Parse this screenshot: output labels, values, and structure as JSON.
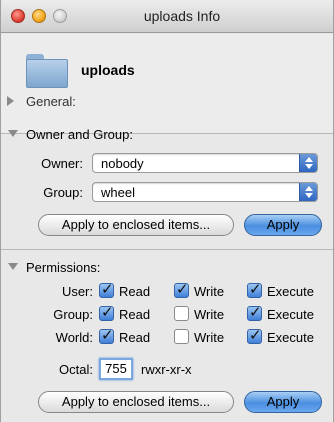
{
  "window": {
    "title": "uploads Info"
  },
  "header": {
    "name": "uploads",
    "general_label": "General:"
  },
  "owner_group": {
    "title": "Owner and Group:",
    "owner_label": "Owner:",
    "owner_value": "nobody",
    "group_label": "Group:",
    "group_value": "wheel",
    "apply_enclosed_label": "Apply to enclosed items...",
    "apply_label": "Apply"
  },
  "permissions": {
    "title": "Permissions:",
    "columns": [
      "Read",
      "Write",
      "Execute"
    ],
    "rows": [
      {
        "label": "User:",
        "read": true,
        "write": true,
        "execute": true
      },
      {
        "label": "Group:",
        "read": true,
        "write": false,
        "execute": true
      },
      {
        "label": "World:",
        "read": true,
        "write": false,
        "execute": true
      }
    ],
    "octal_label": "Octal:",
    "octal_value": "755",
    "symbolic": "rwxr-xr-x",
    "apply_enclosed_label": "Apply to enclosed items...",
    "apply_label": "Apply"
  }
}
